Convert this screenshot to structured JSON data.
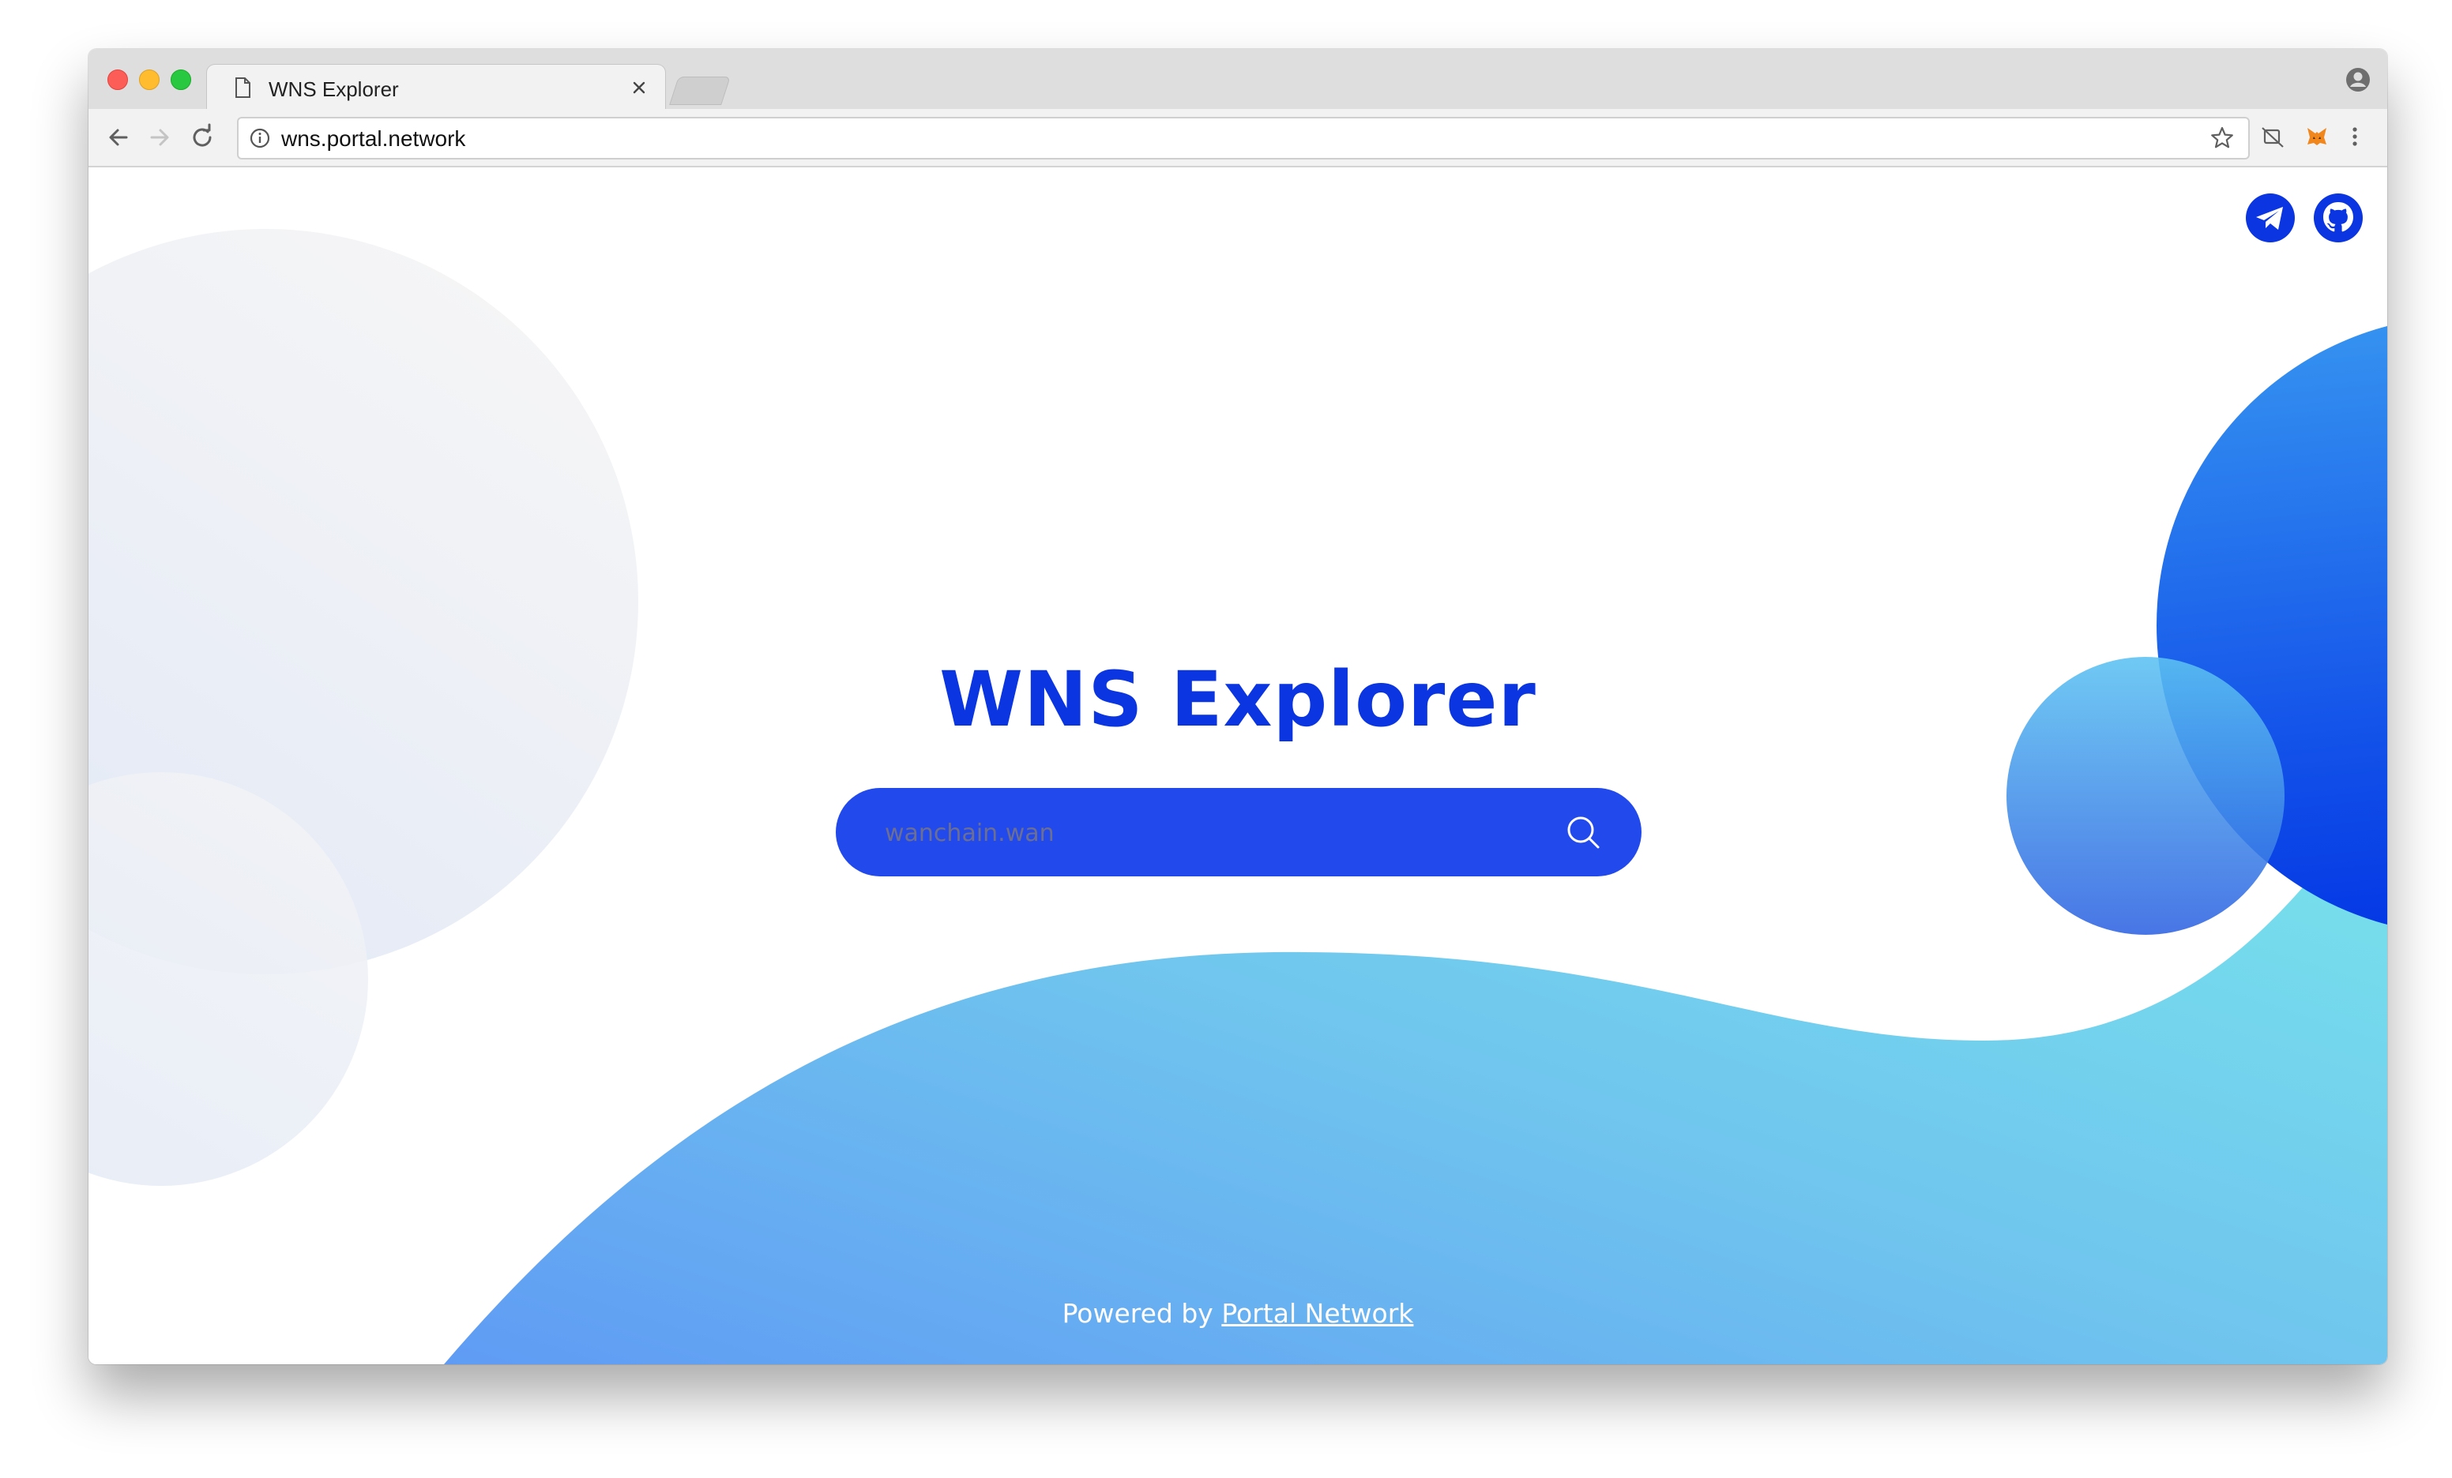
{
  "browser": {
    "tab_title": "WNS Explorer",
    "url": "wns.portal.network"
  },
  "page": {
    "title": "WNS Explorer",
    "search": {
      "placeholder": "wanchain.wan",
      "value": ""
    },
    "footer": {
      "prefix": "Powered by",
      "link_label": "Portal Network"
    }
  },
  "icons": {
    "tab_page": "document-icon",
    "tab_close": "close-icon",
    "profile": "account-icon",
    "back": "arrow-left-icon",
    "forward": "arrow-right-icon",
    "reload": "reload-icon",
    "site_info": "info-icon",
    "bookmark": "star-icon",
    "extension_1": "extension-sync-icon",
    "extension_2": "metamask-fox-icon",
    "menu": "kebab-menu-icon",
    "search": "search-icon",
    "telegram": "telegram-icon",
    "github": "github-icon"
  },
  "colors": {
    "brand_blue": "#0a35e0",
    "search_bg": "#2249ec",
    "wave_start": "#5f9df5",
    "wave_end": "#76e0ec"
  }
}
